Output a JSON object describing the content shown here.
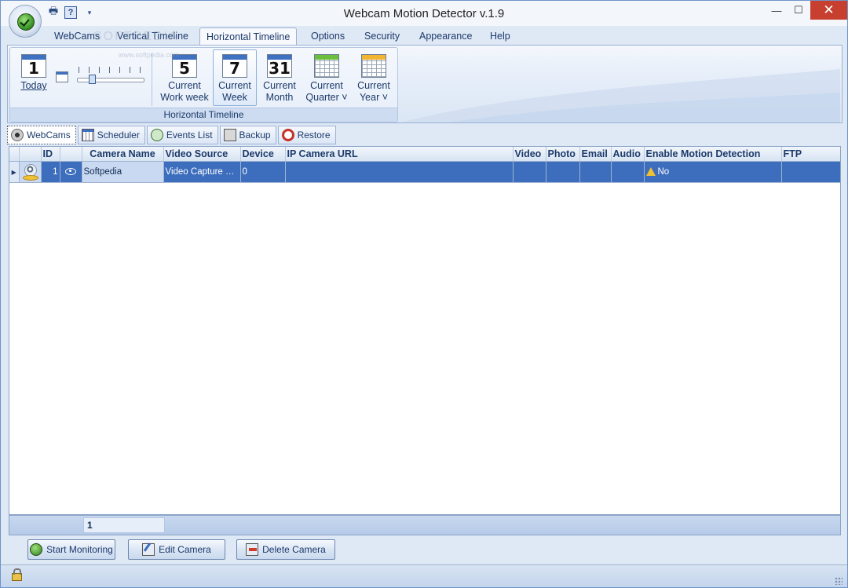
{
  "window": {
    "title": "Webcam Motion Detector v.1.9",
    "minimize_glyph": "—",
    "maximize_glyph": "☐",
    "close_glyph": "✕"
  },
  "quick_access": {
    "print_icon": "printer-icon",
    "help_icon": "help-icon",
    "help_glyph": "?",
    "dropdown_glyph": "▾"
  },
  "ribbon": {
    "tabs": [
      "WebCams",
      "Vertical Timeline",
      "Horizontal Timeline",
      "Options",
      "Security",
      "Appearance",
      "Help"
    ],
    "active_tab": "Horizontal Timeline",
    "watermark": "SOFTPEDIA",
    "watermark_url": "www.softpedia.com",
    "group_caption": "Horizontal Timeline",
    "buttons": {
      "today": {
        "number": "1",
        "label": "Today"
      },
      "work_week": {
        "number": "5",
        "line1": "Current",
        "line2": "Work week"
      },
      "week": {
        "number": "7",
        "line1": "Current",
        "line2": "Week"
      },
      "month": {
        "number": "31",
        "line1": "Current",
        "line2": "Month"
      },
      "quarter": {
        "line1": "Current",
        "line2": "Quarter ˅"
      },
      "year": {
        "line1": "Current",
        "line2": "Year ˅"
      }
    }
  },
  "subtabs": [
    "WebCams",
    "Scheduler",
    "Events List",
    "Backup",
    "Restore"
  ],
  "table": {
    "columns": [
      "",
      "ID",
      "",
      "Camera Name",
      "Video Source",
      "Device",
      "IP Camera URL",
      "Video",
      "Photo",
      "Email",
      "Audio",
      "Enable Motion Detection",
      "FTP"
    ],
    "rows": [
      {
        "indicator": "▶",
        "id": "1",
        "camera_name": "Softpedia",
        "video_source": "Video Capture D...",
        "device": "0",
        "ip_camera_url": "",
        "video": "",
        "photo": "",
        "email": "",
        "audio": "",
        "enable_motion_detection": "No",
        "ftp": ""
      }
    ]
  },
  "footer": {
    "count": "1"
  },
  "actions": {
    "start_monitoring": "Start Monitoring",
    "edit_camera": "Edit Camera",
    "delete_camera": "Delete Camera"
  },
  "colors": {
    "selection_row": "#3d6dbd",
    "accent": "#1c3a6a",
    "close_button": "#c7402f"
  }
}
